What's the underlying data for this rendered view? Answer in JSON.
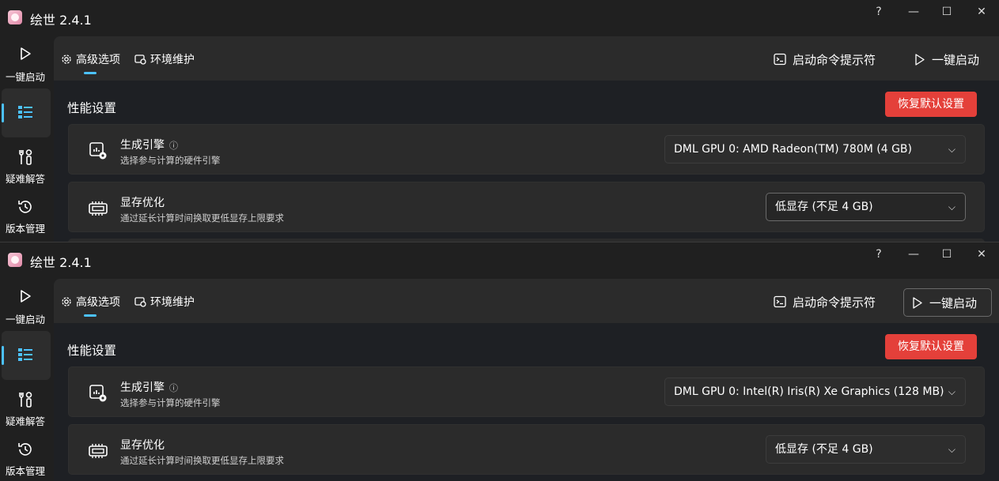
{
  "windows": [
    {
      "app_title": "绘世 2.4.1",
      "window_controls": {
        "help": "?",
        "minimize": "—",
        "maximize": "☐",
        "close": "✕"
      },
      "sidebar": {
        "items": [
          {
            "label": "一键启动",
            "icon": "play-icon"
          },
          {
            "label": "",
            "icon": "list-icon",
            "selected": true
          },
          {
            "label": "疑难解答",
            "icon": "tools-icon"
          },
          {
            "label": "版本管理",
            "icon": "history-icon"
          }
        ]
      },
      "tabs": [
        {
          "label": "高级选项",
          "icon": "gear-icon",
          "active": true
        },
        {
          "label": "环境维护",
          "icon": "maintenance-icon"
        }
      ],
      "actions": {
        "terminal": "启动命令提示符",
        "launch": "一键启动"
      },
      "section_title": "性能设置",
      "reset_button": "恢复默认设置",
      "settings": [
        {
          "title": "生成引擎",
          "help": "ⓘ",
          "subtitle": "选择参与计算的硬件引擎",
          "value": "DML GPU 0: AMD Radeon(TM) 780M (4 GB)"
        },
        {
          "title": "显存优化",
          "subtitle": "通过延长计算时间换取更低显存上限要求",
          "value": "低显存 (不足 4 GB)"
        }
      ]
    },
    {
      "app_title": "绘世 2.4.1",
      "window_controls": {
        "help": "?",
        "minimize": "—",
        "maximize": "☐",
        "close": "✕"
      },
      "sidebar": {
        "items": [
          {
            "label": "一键启动",
            "icon": "play-icon"
          },
          {
            "label": "",
            "icon": "list-icon",
            "selected": true
          },
          {
            "label": "疑难解答",
            "icon": "tools-icon"
          },
          {
            "label": "版本管理",
            "icon": "history-icon"
          }
        ]
      },
      "tabs": [
        {
          "label": "高级选项",
          "icon": "gear-icon",
          "active": true
        },
        {
          "label": "环境维护",
          "icon": "maintenance-icon"
        }
      ],
      "actions": {
        "terminal": "启动命令提示符",
        "launch": "一键启动"
      },
      "section_title": "性能设置",
      "reset_button": "恢复默认设置",
      "settings": [
        {
          "title": "生成引擎",
          "help": "ⓘ",
          "subtitle": "选择参与计算的硬件引擎",
          "value": "DML GPU 0: Intel(R) Iris(R) Xe Graphics (128 MB)"
        },
        {
          "title": "显存优化",
          "subtitle": "通过延长计算时间换取更低显存上限要求",
          "value": "低显存 (不足 4 GB)"
        }
      ]
    }
  ],
  "colors": {
    "accent": "#4cc2ff",
    "danger": "#e4403a",
    "background": "#202020",
    "card": "#2b2b2b"
  }
}
